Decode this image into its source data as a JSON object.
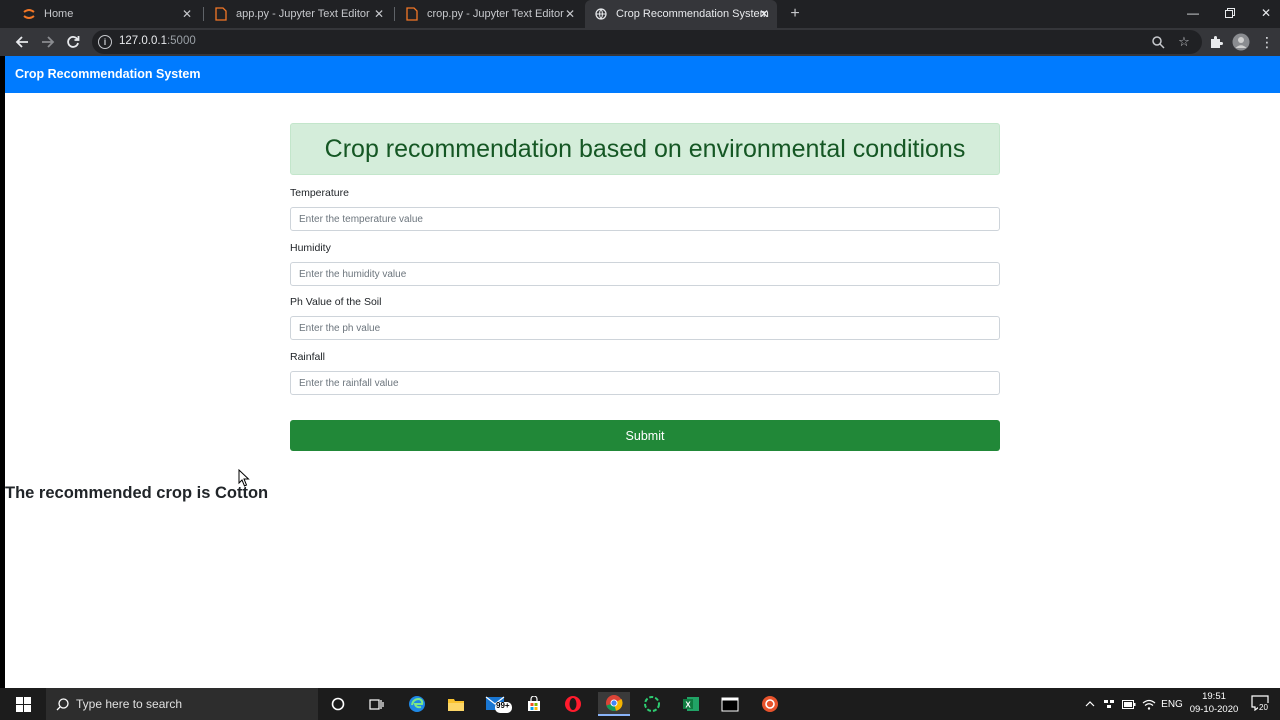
{
  "browser": {
    "tabs": [
      {
        "title": "Home",
        "icon": "jupyter-icon",
        "active": false
      },
      {
        "title": "app.py - Jupyter Text Editor",
        "icon": "file-icon",
        "active": false
      },
      {
        "title": "crop.py - Jupyter Text Editor",
        "icon": "file-icon",
        "active": false
      },
      {
        "title": "Crop Recommendation System",
        "icon": "globe-icon",
        "active": true
      }
    ],
    "url_host": "127.0.0.1",
    "url_port": ":5000"
  },
  "navbar": {
    "brand": "Crop Recommendation System"
  },
  "main": {
    "heading": "Crop recommendation based on environmental conditions",
    "fields": [
      {
        "label": "Temperature",
        "placeholder": "Enter the temperature value"
      },
      {
        "label": "Humidity",
        "placeholder": "Enter the humidity value"
      },
      {
        "label": "Ph Value of the Soil",
        "placeholder": "Enter the ph value"
      },
      {
        "label": "Rainfall",
        "placeholder": "Enter the rainfall value"
      }
    ],
    "submit_label": "Submit",
    "result": "The recommended crop is Cotton"
  },
  "taskbar": {
    "search_placeholder": "Type here to search",
    "mail_badge": "99+",
    "language": "ENG",
    "time": "19:51",
    "date": "09-10-2020",
    "notifications": "20"
  },
  "colors": {
    "navbar": "#007bff",
    "alert_bg": "#d4edda",
    "alert_text": "#155724",
    "submit": "#218838"
  }
}
